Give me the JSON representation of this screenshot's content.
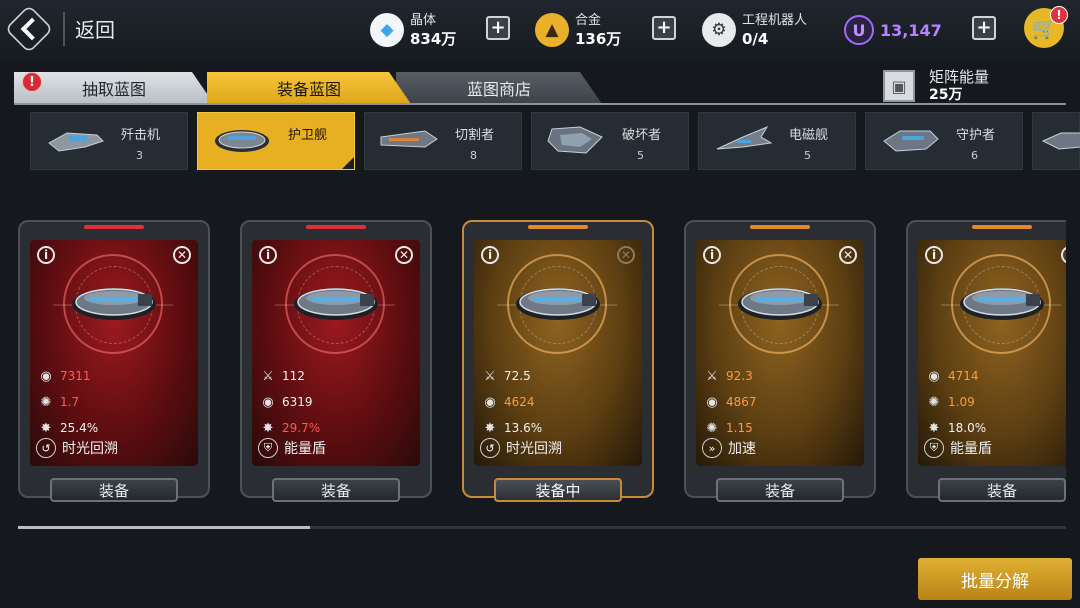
{
  "header": {
    "back_label": "返回",
    "crystal": {
      "name": "晶体",
      "value": "834万"
    },
    "alloy": {
      "name": "合金",
      "value": "136万"
    },
    "robot": {
      "name": "工程机器人",
      "value": "0/4"
    },
    "u_currency": {
      "symbol": "U",
      "value": "13,147"
    },
    "cart_badge": "!"
  },
  "tabs": [
    {
      "label": "抽取蓝图",
      "alert": "!"
    },
    {
      "label": "装备蓝图"
    },
    {
      "label": "蓝图商店"
    }
  ],
  "matrix_energy": {
    "name": "矩阵能量",
    "value": "25万"
  },
  "ship_types": [
    {
      "name": "歼击机",
      "count": "3"
    },
    {
      "name": "护卫舰",
      "count": ""
    },
    {
      "name": "切割者",
      "count": "8"
    },
    {
      "name": "破坏者",
      "count": "5"
    },
    {
      "name": "电磁舰",
      "count": "5"
    },
    {
      "name": "守护者",
      "count": "6"
    }
  ],
  "cards": [
    {
      "theme": "red",
      "stats": [
        {
          "icon": "armor-icon",
          "value": "7311",
          "color": "red"
        },
        {
          "icon": "regen-icon",
          "value": "1.7",
          "color": "red"
        },
        {
          "icon": "crit-icon",
          "value": "25.4%",
          "color": "white"
        }
      ],
      "skill": "时光回溯",
      "skill_icon": "time-rewind-icon",
      "button": "装备"
    },
    {
      "theme": "red",
      "stats": [
        {
          "icon": "attack-icon",
          "value": "112",
          "color": "white"
        },
        {
          "icon": "armor-icon",
          "value": "6319",
          "color": "white"
        },
        {
          "icon": "crit-icon",
          "value": "29.7%",
          "color": "red"
        }
      ],
      "skill": "能量盾",
      "skill_icon": "energy-shield-icon",
      "button": "装备"
    },
    {
      "theme": "gold",
      "stats": [
        {
          "icon": "attack-icon",
          "value": "72.5",
          "color": "white"
        },
        {
          "icon": "armor-icon",
          "value": "4624",
          "color": "orange"
        },
        {
          "icon": "crit-icon",
          "value": "13.6%",
          "color": "white"
        }
      ],
      "skill": "时光回溯",
      "skill_icon": "time-rewind-icon",
      "button": "装备中"
    },
    {
      "theme": "gold",
      "stats": [
        {
          "icon": "attack-icon",
          "value": "92.3",
          "color": "orange"
        },
        {
          "icon": "armor-icon",
          "value": "4867",
          "color": "orange"
        },
        {
          "icon": "regen-icon",
          "value": "1.15",
          "color": "orange"
        }
      ],
      "skill": "加速",
      "skill_icon": "speed-boost-icon",
      "button": "装备"
    },
    {
      "theme": "gold",
      "stats": [
        {
          "icon": "armor-icon",
          "value": "4714",
          "color": "orange"
        },
        {
          "icon": "regen-icon",
          "value": "1.09",
          "color": "orange"
        },
        {
          "icon": "crit-icon",
          "value": "18.0%",
          "color": "white"
        }
      ],
      "skill": "能量盾",
      "skill_icon": "energy-shield-icon",
      "button": "装备"
    }
  ],
  "batch_button": "批量分解",
  "colors": {
    "accent_gold": "#e6b022",
    "red_value": "#ff5959",
    "orange_value": "#ff9b3a",
    "u_purple": "#b782ff"
  }
}
